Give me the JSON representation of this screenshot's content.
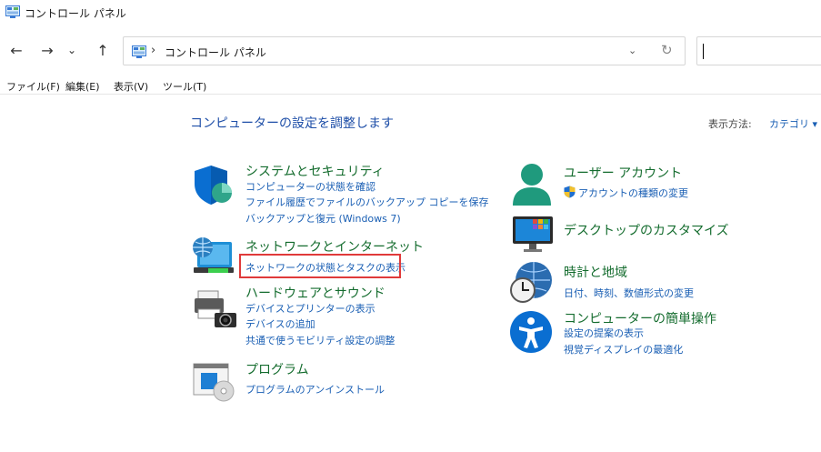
{
  "window": {
    "title": "コントロール パネル"
  },
  "nav": {
    "back": "←",
    "forward": "→",
    "recent": "⌄",
    "up": "↑",
    "address_separator": "›",
    "address_path": "コントロール パネル",
    "address_dropdown": "⌄",
    "refresh": "↻"
  },
  "search": {
    "value": ""
  },
  "menu": [
    "ファイル(F)",
    "編集(E)",
    "表示(V)",
    "ツール(T)"
  ],
  "main": {
    "heading": "コンピューターの設定を調整します",
    "view_by_label": "表示方法:",
    "view_by_value": "カテゴリ ▾"
  },
  "categories": {
    "system": {
      "title": "システムとセキュリティ",
      "links": [
        "コンピューターの状態を確認",
        "ファイル履歴でファイルのバックアップ コピーを保存",
        "バックアップと復元 (Windows 7)"
      ]
    },
    "network": {
      "title": "ネットワークとインターネット",
      "links": [
        "ネットワークの状態とタスクの表示"
      ]
    },
    "hardware": {
      "title": "ハードウェアとサウンド",
      "links": [
        "デバイスとプリンターの表示",
        "デバイスの追加",
        "共通で使うモビリティ設定の調整"
      ]
    },
    "programs": {
      "title": "プログラム",
      "links": [
        "プログラムのアンインストール"
      ]
    },
    "user": {
      "title": "ユーザー アカウント",
      "links": [
        "アカウントの種類の変更"
      ]
    },
    "desktop": {
      "title": "デスクトップのカスタマイズ",
      "links": []
    },
    "clock": {
      "title": "時計と地域",
      "links": [
        "日付、時刻、数値形式の変更"
      ]
    },
    "ease": {
      "title": "コンピューターの簡単操作",
      "links": [
        "設定の提案の表示",
        "視覚ディスプレイの最適化"
      ]
    }
  },
  "colors": {
    "category_title": "#146c2e",
    "link": "#1a5fb4",
    "highlight": "#e03a3a",
    "accent_blue": "#0a6ed1",
    "accent_teal": "#2a9d8f"
  }
}
